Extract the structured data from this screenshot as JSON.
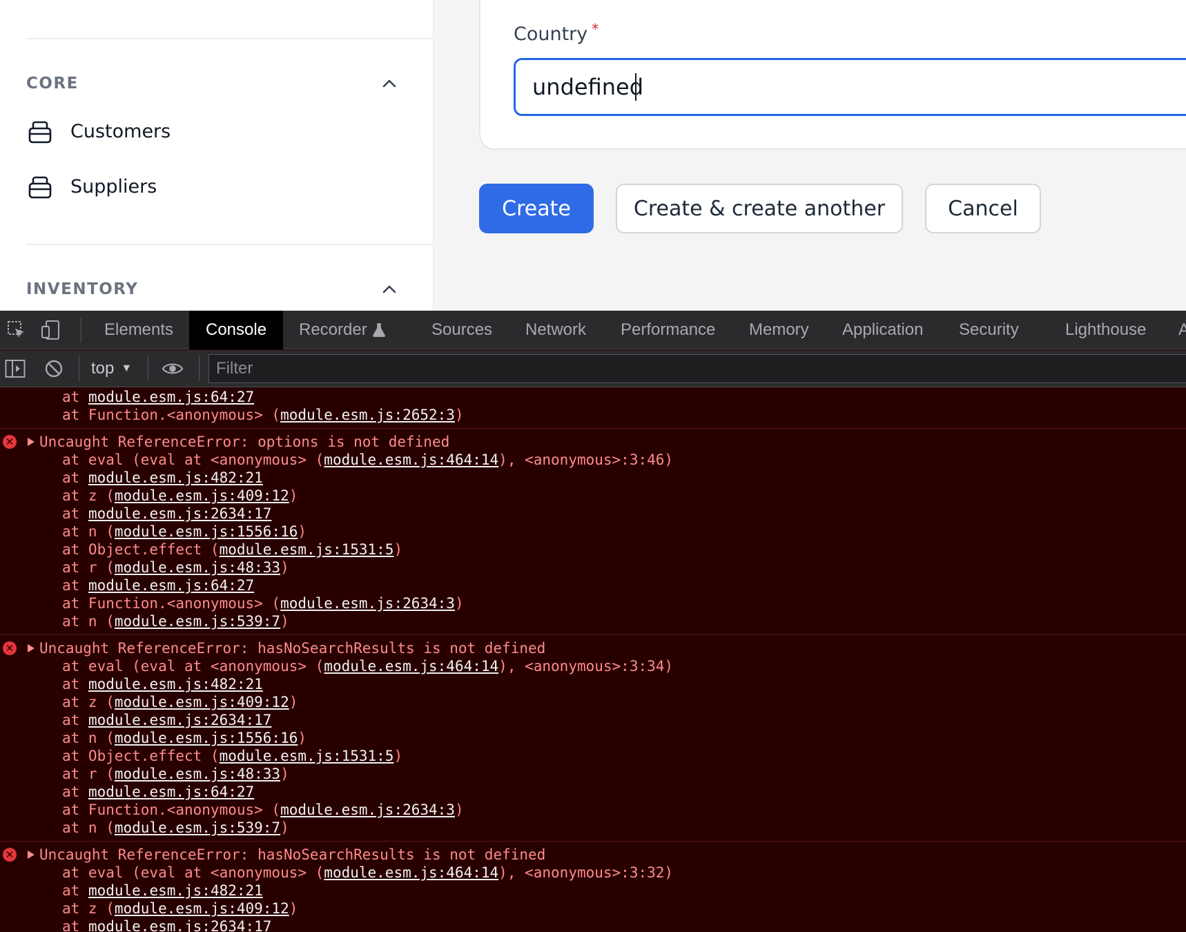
{
  "sidebar": {
    "groups": [
      {
        "title": "CORE",
        "items": [
          {
            "label": "Customers",
            "icon": "package-icon"
          },
          {
            "label": "Suppliers",
            "icon": "package-icon"
          }
        ]
      },
      {
        "title": "INVENTORY",
        "items": []
      }
    ]
  },
  "form": {
    "field_label": "Country",
    "required_mark": "*",
    "country_value": "undefined",
    "buttons": {
      "create": "Create",
      "create_another": "Create & create another",
      "cancel": "Cancel"
    }
  },
  "devtools": {
    "tabs": [
      "Elements",
      "Console",
      "Recorder",
      "Sources",
      "Network",
      "Performance",
      "Memory",
      "Application",
      "Security",
      "Lighthouse",
      "A"
    ],
    "active_tab": "Console",
    "context": "top",
    "filter_placeholder": "Filter"
  },
  "console": {
    "entries": [
      {
        "error": false,
        "lines": [
          [
            {
              "t": "at "
            },
            {
              "t": "module.esm.js:64:27",
              "link": true
            }
          ],
          [
            {
              "t": "at Function.<anonymous> ("
            },
            {
              "t": "module.esm.js:2652:3",
              "link": true
            },
            {
              "t": ")"
            }
          ]
        ]
      },
      {
        "error": true,
        "message": "Uncaught ReferenceError: options is not defined",
        "lines": [
          [
            {
              "t": "at eval (eval at <anonymous> ("
            },
            {
              "t": "module.esm.js:464:14",
              "link": true
            },
            {
              "t": "), <anonymous>:3:46)"
            }
          ],
          [
            {
              "t": "at "
            },
            {
              "t": "module.esm.js:482:21",
              "link": true
            }
          ],
          [
            {
              "t": "at z ("
            },
            {
              "t": "module.esm.js:409:12",
              "link": true
            },
            {
              "t": ")"
            }
          ],
          [
            {
              "t": "at "
            },
            {
              "t": "module.esm.js:2634:17",
              "link": true
            }
          ],
          [
            {
              "t": "at n ("
            },
            {
              "t": "module.esm.js:1556:16",
              "link": true
            },
            {
              "t": ")"
            }
          ],
          [
            {
              "t": "at Object.effect ("
            },
            {
              "t": "module.esm.js:1531:5",
              "link": true
            },
            {
              "t": ")"
            }
          ],
          [
            {
              "t": "at r ("
            },
            {
              "t": "module.esm.js:48:33",
              "link": true
            },
            {
              "t": ")"
            }
          ],
          [
            {
              "t": "at "
            },
            {
              "t": "module.esm.js:64:27",
              "link": true
            }
          ],
          [
            {
              "t": "at Function.<anonymous> ("
            },
            {
              "t": "module.esm.js:2634:3",
              "link": true
            },
            {
              "t": ")"
            }
          ],
          [
            {
              "t": "at n ("
            },
            {
              "t": "module.esm.js:539:7",
              "link": true
            },
            {
              "t": ")"
            }
          ]
        ]
      },
      {
        "error": true,
        "message": "Uncaught ReferenceError: hasNoSearchResults is not defined",
        "lines": [
          [
            {
              "t": "at eval (eval at <anonymous> ("
            },
            {
              "t": "module.esm.js:464:14",
              "link": true
            },
            {
              "t": "), <anonymous>:3:34)"
            }
          ],
          [
            {
              "t": "at "
            },
            {
              "t": "module.esm.js:482:21",
              "link": true
            }
          ],
          [
            {
              "t": "at z ("
            },
            {
              "t": "module.esm.js:409:12",
              "link": true
            },
            {
              "t": ")"
            }
          ],
          [
            {
              "t": "at "
            },
            {
              "t": "module.esm.js:2634:17",
              "link": true
            }
          ],
          [
            {
              "t": "at n ("
            },
            {
              "t": "module.esm.js:1556:16",
              "link": true
            },
            {
              "t": ")"
            }
          ],
          [
            {
              "t": "at Object.effect ("
            },
            {
              "t": "module.esm.js:1531:5",
              "link": true
            },
            {
              "t": ")"
            }
          ],
          [
            {
              "t": "at r ("
            },
            {
              "t": "module.esm.js:48:33",
              "link": true
            },
            {
              "t": ")"
            }
          ],
          [
            {
              "t": "at "
            },
            {
              "t": "module.esm.js:64:27",
              "link": true
            }
          ],
          [
            {
              "t": "at Function.<anonymous> ("
            },
            {
              "t": "module.esm.js:2634:3",
              "link": true
            },
            {
              "t": ")"
            }
          ],
          [
            {
              "t": "at n ("
            },
            {
              "t": "module.esm.js:539:7",
              "link": true
            },
            {
              "t": ")"
            }
          ]
        ]
      },
      {
        "error": true,
        "message": "Uncaught ReferenceError: hasNoSearchResults is not defined",
        "lines": [
          [
            {
              "t": "at eval (eval at <anonymous> ("
            },
            {
              "t": "module.esm.js:464:14",
              "link": true
            },
            {
              "t": "), <anonymous>:3:32)"
            }
          ],
          [
            {
              "t": "at "
            },
            {
              "t": "module.esm.js:482:21",
              "link": true
            }
          ],
          [
            {
              "t": "at z ("
            },
            {
              "t": "module.esm.js:409:12",
              "link": true
            },
            {
              "t": ")"
            }
          ],
          [
            {
              "t": "at "
            },
            {
              "t": "module.esm.js:2634:17",
              "link": true
            }
          ]
        ]
      }
    ]
  }
}
